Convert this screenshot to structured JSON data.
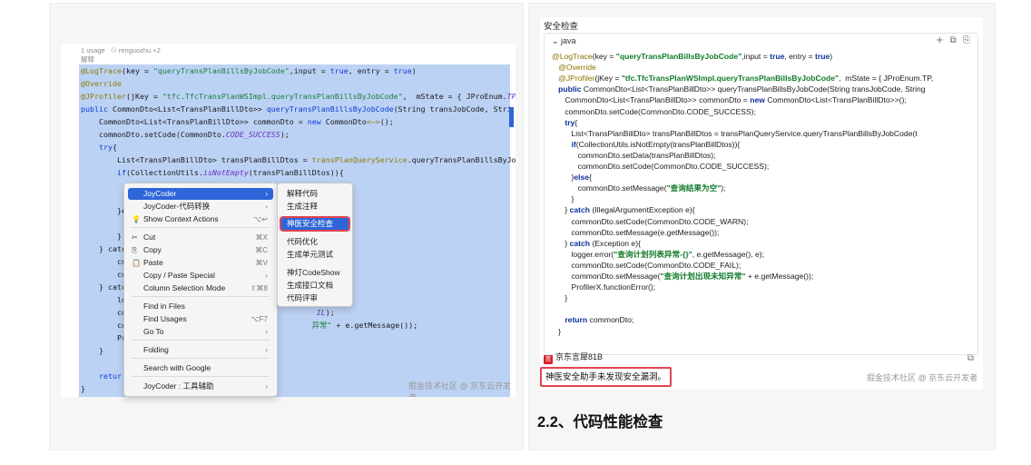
{
  "ide": {
    "usage": "1 usage",
    "author": "renguozhu +2",
    "doc": "解释",
    "lines": [
      [
        [
          "ann",
          "@LogTrace"
        ],
        [
          "",
          "(key = "
        ],
        [
          "str",
          "\"queryTransPlanBillsByJobCode\""
        ],
        [
          "",
          ",input = "
        ],
        [
          "kw",
          "true"
        ],
        [
          "",
          ", entry = "
        ],
        [
          "kw",
          "true"
        ],
        [
          "",
          ")"
        ]
      ],
      [
        [
          "ann",
          "@Override"
        ]
      ],
      [
        [
          "ann",
          "@JProfiler"
        ],
        [
          "",
          "(jKey = "
        ],
        [
          "str",
          "\"tfc.TfcTransPlanWSImpl.queryTransPlanBillsByJobCode\""
        ],
        [
          "",
          ",  mState = { JProEnum."
        ],
        [
          "ital",
          "TP"
        ]
      ],
      [
        [
          "kw",
          "public "
        ],
        [
          "",
          "CommonDto<List<TransPlanBillDto>> "
        ],
        [
          "kw",
          "queryTransPlanBillsByJobCode"
        ],
        [
          "",
          "(String transJobCode, Stri"
        ]
      ],
      [
        [
          "",
          "    CommonDto<List<TransPlanBillDto>> commonDto = "
        ],
        [
          "kw",
          "new "
        ],
        [
          "",
          "CommonDto"
        ],
        [
          "ann",
          "<~>"
        ],
        [
          "",
          "();"
        ]
      ],
      [
        [
          "",
          "    commonDto.setCode(CommonDto."
        ],
        [
          "ital",
          "CODE_SUCCESS"
        ],
        [
          "",
          ");"
        ]
      ],
      [
        [
          "kw",
          "    try"
        ],
        [
          "",
          "{"
        ]
      ],
      [
        [
          "",
          "        List<TransPlanBillDto> transPlanBillDtos = "
        ],
        [
          "ann",
          "transPlanQueryService"
        ],
        [
          "",
          ".queryTransPlanBillsByJobCo"
        ]
      ],
      [
        [
          "kw",
          "        if"
        ],
        [
          "",
          "(CollectionUtils."
        ],
        [
          "ital",
          "isNotEmpty"
        ],
        [
          "",
          "(transPlanBillDtos)){"
        ]
      ],
      [
        [
          "",
          "            "
        ]
      ],
      [
        [
          "",
          "            "
        ]
      ],
      [
        [
          "",
          "        }e"
        ]
      ],
      [
        [
          "",
          "            "
        ]
      ],
      [
        [
          "",
          "        }"
        ]
      ],
      [
        [
          "",
          "    } catc"
        ]
      ],
      [
        [
          "",
          "        co"
        ]
      ],
      [
        [
          "",
          "        co"
        ]
      ],
      [
        [
          "",
          "    } catc"
        ]
      ],
      [
        [
          "",
          "        lo"
        ]
      ],
      [
        [
          "",
          "        co                                          "
        ],
        [
          "ital",
          "IL"
        ],
        [
          "",
          ");"
        ]
      ],
      [
        [
          "",
          "        co                                         "
        ],
        [
          "str",
          "异常\""
        ],
        [
          "",
          " + e.getMessage());"
        ]
      ],
      [
        [
          "",
          "        Pr"
        ]
      ],
      [
        [
          "",
          "    }"
        ]
      ],
      [
        [
          "",
          "    "
        ]
      ],
      [
        [
          "kw",
          "    retur"
        ]
      ],
      [
        [
          "",
          "}"
        ]
      ]
    ],
    "watermark": "掘金技术社区 @ 京东云开发者"
  },
  "context_menu": {
    "items": [
      {
        "label": "JoyCoder",
        "shortcut": "›",
        "icon": "",
        "active": true
      },
      {
        "label": "JoyCoder-代码转换",
        "shortcut": "›",
        "icon": ""
      },
      {
        "label": "Show Context Actions",
        "shortcut": "⌥↩",
        "icon": "bulb-icon"
      },
      {
        "label": "Cut",
        "shortcut": "⌘X",
        "icon": "scissors-icon"
      },
      {
        "label": "Copy",
        "shortcut": "⌘C",
        "icon": "copy-icon"
      },
      {
        "label": "Paste",
        "shortcut": "⌘V",
        "icon": "paste-icon"
      },
      {
        "label": "Copy / Paste Special",
        "shortcut": "›",
        "icon": ""
      },
      {
        "label": "Column Selection Mode",
        "shortcut": "⇧⌘8",
        "icon": ""
      },
      {
        "label": "Find in Files",
        "shortcut": "",
        "icon": ""
      },
      {
        "label": "Find Usages",
        "shortcut": "⌥F7",
        "icon": ""
      },
      {
        "label": "Go To",
        "shortcut": "›",
        "icon": ""
      },
      {
        "label": "Folding",
        "shortcut": "›",
        "icon": ""
      },
      {
        "label": "Search with Google",
        "shortcut": "",
        "icon": ""
      },
      {
        "label": "JoyCoder : 工具辅助",
        "shortcut": "›",
        "icon": ""
      }
    ]
  },
  "submenu": {
    "items": [
      "解释代码",
      "生成注释",
      "神医安全检查",
      "代码优化",
      "生成单元测试",
      "神灯CodeShow",
      "生成接口文档",
      "代码评审"
    ],
    "active_index": 2
  },
  "security": {
    "title": "安全检查",
    "lang": "java",
    "tools": "+ ⧉ ⎘",
    "lines": [
      [
        [
          "ann",
          "@LogTrace"
        ],
        [
          "",
          "(key = "
        ],
        [
          "str",
          "\"queryTransPlanBillsByJobCode\""
        ],
        [
          "",
          ",input = "
        ],
        [
          "kw",
          "true"
        ],
        [
          "",
          ", entry = "
        ],
        [
          "kw",
          "true"
        ],
        [
          "",
          ")"
        ]
      ],
      [
        [
          "ann",
          "   @Override"
        ]
      ],
      [
        [
          "ann",
          "   @JProfiler"
        ],
        [
          "",
          "(jKey = "
        ],
        [
          "str",
          "\"tfc.TfcTransPlanWSImpl.queryTransPlanBillsByJobCode\""
        ],
        [
          "",
          ",  mState = { JProEnum.TP,"
        ]
      ],
      [
        [
          "kw",
          "   public "
        ],
        [
          "",
          "CommonDto<List<TransPlanBillDto>> queryTransPlanBillsByJobCode(String transJobCode, String"
        ]
      ],
      [
        [
          "",
          "      CommonDto<List<TransPlanBillDto>> commonDto = "
        ],
        [
          "kw",
          "new "
        ],
        [
          "",
          "CommonDto<List<TransPlanBillDto>>();"
        ]
      ],
      [
        [
          "",
          "      commonDto.setCode(CommonDto.CODE_SUCCESS);"
        ]
      ],
      [
        [
          "kw",
          "      try"
        ],
        [
          "",
          "{"
        ]
      ],
      [
        [
          "",
          "         List<TransPlanBillDto> transPlanBillDtos = transPlanQueryService.queryTransPlanBillsByJobCode(t"
        ]
      ],
      [
        [
          "kw",
          "         if"
        ],
        [
          "",
          "(CollectionUtils.isNotEmpty(transPlanBillDtos)){"
        ]
      ],
      [
        [
          "",
          "            commonDto.setData(transPlanBillDtos);"
        ]
      ],
      [
        [
          "",
          "            commonDto.setCode(CommonDto.CODE_SUCCESS);"
        ]
      ],
      [
        [
          "",
          "         }"
        ],
        [
          "kw",
          "else"
        ],
        [
          "",
          "{"
        ]
      ],
      [
        [
          "",
          "            commonDto.setMessage("
        ],
        [
          "str",
          "\"查询结果为空\""
        ],
        [
          "",
          ");"
        ]
      ],
      [
        [
          "",
          "         }"
        ]
      ],
      [
        [
          "",
          "      } "
        ],
        [
          "kw",
          "catch "
        ],
        [
          "",
          "(IllegalArgumentException e){"
        ]
      ],
      [
        [
          "",
          "         commonDto.setCode(CommonDto.CODE_WARN);"
        ]
      ],
      [
        [
          "",
          "         commonDto.setMessage(e.getMessage());"
        ]
      ],
      [
        [
          "",
          "      } "
        ],
        [
          "kw",
          "catch "
        ],
        [
          "",
          "(Exception e){"
        ]
      ],
      [
        [
          "",
          "         logger.error("
        ],
        [
          "str",
          "\"查询计划列表异常-{}\""
        ],
        [
          "",
          ", e.getMessage(), e);"
        ]
      ],
      [
        [
          "",
          "         commonDto.setCode(CommonDto.CODE_FAIL);"
        ]
      ],
      [
        [
          "",
          "         commonDto.setMessage("
        ],
        [
          "str",
          "\"查询计划出现未知异常\""
        ],
        [
          "",
          " + e.getMessage());"
        ]
      ],
      [
        [
          "",
          "         ProfilerX.functionError();"
        ]
      ],
      [
        [
          "",
          "      }"
        ]
      ],
      [
        [
          "",
          ""
        ]
      ],
      [
        [
          "kw",
          "      return "
        ],
        [
          "",
          "commonDto;"
        ]
      ],
      [
        [
          "",
          "   }"
        ]
      ]
    ],
    "model_name": "京东言犀81B",
    "model_logo": "言",
    "copy_icon": "⧉",
    "result": "神医安全助手未发现安全漏洞。",
    "watermark": "掘金技术社区 @ 京东云开发者"
  },
  "heading": "2.2、代码性能检查"
}
